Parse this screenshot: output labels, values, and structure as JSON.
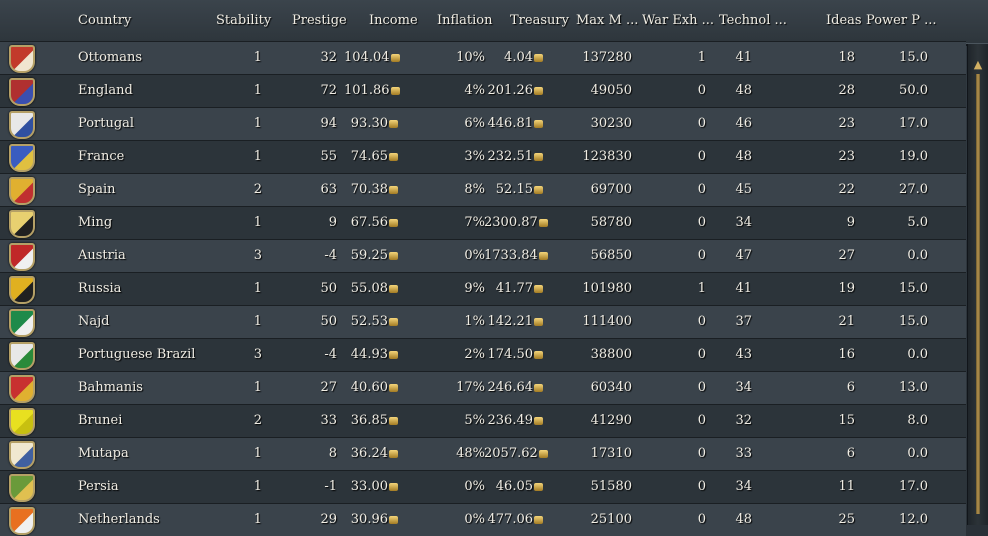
{
  "columns": [
    "Country",
    "Stability",
    "Prestige",
    "Income",
    "Inflation",
    "Treasury",
    "Max M ...",
    "War Exh ...",
    "Technol ...",
    "Ideas",
    "Power P ..."
  ],
  "rows": [
    {
      "country": "Ottomans",
      "stability": "1",
      "prestige": "32",
      "income": "104.04",
      "inflation": "10%",
      "treasury": "4.04",
      "max_manpower": "137280",
      "war_exhaustion": "1",
      "technology": "41",
      "ideas": "18",
      "power_projection": "15.0",
      "flag_color": "#c23a2b",
      "flag_accent": "#f0e6d0"
    },
    {
      "country": "England",
      "stability": "1",
      "prestige": "72",
      "income": "101.86",
      "inflation": "4%",
      "treasury": "201.26",
      "max_manpower": "49050",
      "war_exhaustion": "0",
      "technology": "48",
      "ideas": "28",
      "power_projection": "50.0",
      "flag_color": "#b03030",
      "flag_accent": "#3a4fb0"
    },
    {
      "country": "Portugal",
      "stability": "1",
      "prestige": "94",
      "income": "93.30",
      "inflation": "6%",
      "treasury": "446.81",
      "max_manpower": "30230",
      "war_exhaustion": "0",
      "technology": "46",
      "ideas": "23",
      "power_projection": "17.0",
      "flag_color": "#e8e8e8",
      "flag_accent": "#3050a0"
    },
    {
      "country": "France",
      "stability": "1",
      "prestige": "55",
      "income": "74.65",
      "inflation": "3%",
      "treasury": "232.51",
      "max_manpower": "123830",
      "war_exhaustion": "0",
      "technology": "48",
      "ideas": "23",
      "power_projection": "19.0",
      "flag_color": "#3a5cc0",
      "flag_accent": "#e0c040"
    },
    {
      "country": "Spain",
      "stability": "2",
      "prestige": "63",
      "income": "70.38",
      "inflation": "8%",
      "treasury": "52.15",
      "max_manpower": "69700",
      "war_exhaustion": "0",
      "technology": "45",
      "ideas": "22",
      "power_projection": "27.0",
      "flag_color": "#e0b030",
      "flag_accent": "#c03030"
    },
    {
      "country": "Ming",
      "stability": "1",
      "prestige": "9",
      "income": "67.56",
      "inflation": "7%",
      "treasury": "2300.87",
      "max_manpower": "58780",
      "war_exhaustion": "0",
      "technology": "34",
      "ideas": "9",
      "power_projection": "5.0",
      "flag_color": "#e8d070",
      "flag_accent": "#202020"
    },
    {
      "country": "Austria",
      "stability": "3",
      "prestige": "-4",
      "income": "59.25",
      "inflation": "0%",
      "treasury": "1733.84",
      "max_manpower": "56850",
      "war_exhaustion": "0",
      "technology": "47",
      "ideas": "27",
      "power_projection": "0.0",
      "flag_color": "#c02828",
      "flag_accent": "#f0f0f0"
    },
    {
      "country": "Russia",
      "stability": "1",
      "prestige": "50",
      "income": "55.08",
      "inflation": "9%",
      "treasury": "41.77",
      "max_manpower": "101980",
      "war_exhaustion": "1",
      "technology": "41",
      "ideas": "19",
      "power_projection": "15.0",
      "flag_color": "#e0b020",
      "flag_accent": "#202020"
    },
    {
      "country": "Najd",
      "stability": "1",
      "prestige": "50",
      "income": "52.53",
      "inflation": "1%",
      "treasury": "142.21",
      "max_manpower": "111400",
      "war_exhaustion": "0",
      "technology": "37",
      "ideas": "21",
      "power_projection": "15.0",
      "flag_color": "#1e8a4a",
      "flag_accent": "#f0f0f0"
    },
    {
      "country": "Portuguese Brazil",
      "stability": "3",
      "prestige": "-4",
      "income": "44.93",
      "inflation": "2%",
      "treasury": "174.50",
      "max_manpower": "38800",
      "war_exhaustion": "0",
      "technology": "43",
      "ideas": "16",
      "power_projection": "0.0",
      "flag_color": "#e8e8e8",
      "flag_accent": "#2a8a3a"
    },
    {
      "country": "Bahmanis",
      "stability": "1",
      "prestige": "27",
      "income": "40.60",
      "inflation": "17%",
      "treasury": "246.64",
      "max_manpower": "60340",
      "war_exhaustion": "0",
      "technology": "34",
      "ideas": "6",
      "power_projection": "13.0",
      "flag_color": "#c83030",
      "flag_accent": "#e0b030"
    },
    {
      "country": "Brunei",
      "stability": "2",
      "prestige": "33",
      "income": "36.85",
      "inflation": "5%",
      "treasury": "236.49",
      "max_manpower": "41290",
      "war_exhaustion": "0",
      "technology": "32",
      "ideas": "15",
      "power_projection": "8.0",
      "flag_color": "#e8e020",
      "flag_accent": "#c8c010"
    },
    {
      "country": "Mutapa",
      "stability": "1",
      "prestige": "8",
      "income": "36.24",
      "inflation": "48%",
      "treasury": "2057.62",
      "max_manpower": "17310",
      "war_exhaustion": "0",
      "technology": "33",
      "ideas": "6",
      "power_projection": "0.0",
      "flag_color": "#f0e8d0",
      "flag_accent": "#4060a0"
    },
    {
      "country": "Persia",
      "stability": "1",
      "prestige": "-1",
      "income": "33.00",
      "inflation": "0%",
      "treasury": "46.05",
      "max_manpower": "51580",
      "war_exhaustion": "0",
      "technology": "34",
      "ideas": "11",
      "power_projection": "17.0",
      "flag_color": "#6a9a3a",
      "flag_accent": "#e0c050"
    },
    {
      "country": "Netherlands",
      "stability": "1",
      "prestige": "29",
      "income": "30.96",
      "inflation": "0%",
      "treasury": "477.06",
      "max_manpower": "25100",
      "war_exhaustion": "0",
      "technology": "48",
      "ideas": "25",
      "power_projection": "12.0",
      "flag_color": "#e87020",
      "flag_accent": "#f0f0f0"
    }
  ],
  "icons": {
    "currency": "ducat-coin-icon",
    "scroll_up": "scroll-up-arrow-icon"
  }
}
